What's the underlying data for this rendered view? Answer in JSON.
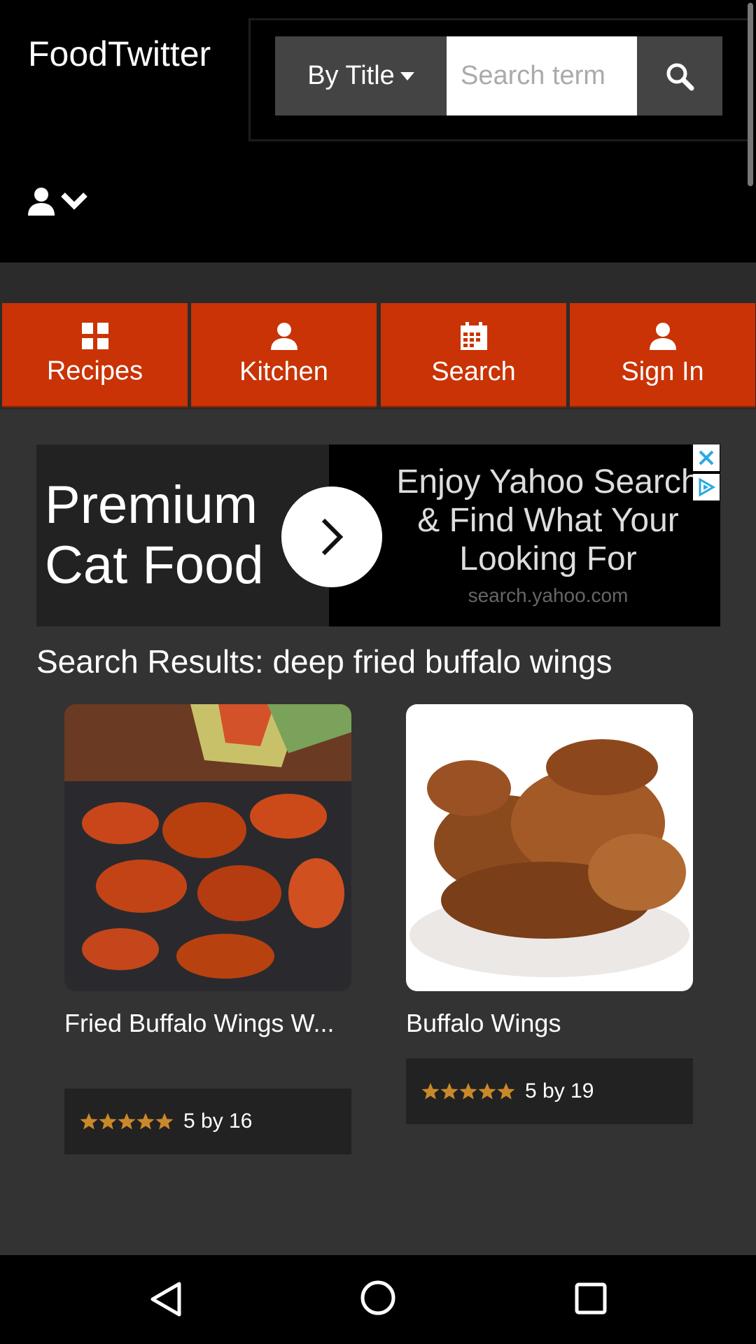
{
  "header": {
    "brand": "FoodTwitter",
    "search_mode": "By Title",
    "search_placeholder": "Search term"
  },
  "nav": [
    {
      "label": "Recipes",
      "icon": "grid-icon"
    },
    {
      "label": "Kitchen",
      "icon": "person-icon"
    },
    {
      "label": "Search",
      "icon": "calendar-icon"
    },
    {
      "label": "Sign In",
      "icon": "person-icon"
    }
  ],
  "ad": {
    "headline": "Premium Cat Food",
    "text": "Enjoy Yahoo Search & Find What Your Looking For",
    "url": "search.yahoo.com"
  },
  "results": {
    "title": "Search Results: deep fried buffalo wings",
    "items": [
      {
        "title": "Fried Buffalo Wings W...",
        "rating_text": "5 by 16",
        "stars": 5
      },
      {
        "title": "Buffalo Wings",
        "rating_text": "5 by 19",
        "stars": 5
      }
    ]
  },
  "colors": {
    "accent": "#c93305",
    "background": "#333333",
    "star": "#c9892a"
  }
}
